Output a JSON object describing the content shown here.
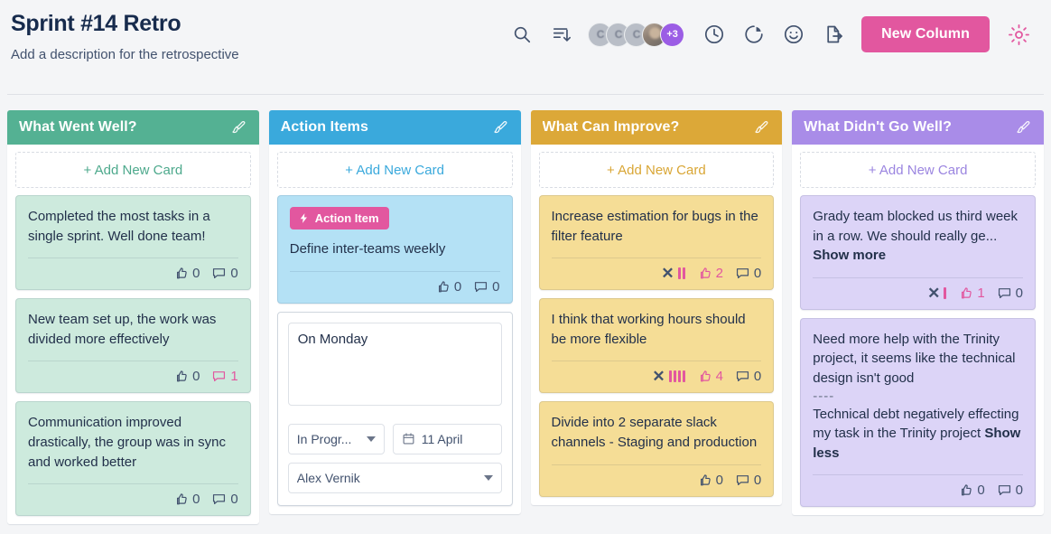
{
  "header": {
    "title": "Sprint #14 Retro",
    "description": "Add a description for the retrospective",
    "search_icon": "search-icon",
    "sort_icon": "sort-descending-icon",
    "timer_icon": "clock-icon",
    "chart_icon": "pie-chart-icon",
    "mood_icon": "smiley-icon",
    "export_icon": "export-icon",
    "settings_icon": "gear-icon",
    "new_column_label": "New Column",
    "avatars": [
      {
        "initials": "C",
        "type": "initials"
      },
      {
        "initials": "C",
        "type": "initials"
      },
      {
        "initials": "C",
        "type": "initials"
      },
      {
        "initials": "",
        "type": "photo"
      }
    ],
    "avatar_overflow": "+3"
  },
  "colors": {
    "accent_pink": "#e2579f",
    "green": "#54b193",
    "blue": "#3aa9dc",
    "amber": "#dca838",
    "purple": "#a98ce8",
    "page_bg": "#f4f5f7"
  },
  "add_card_label": "+ Add New Card",
  "columns": [
    {
      "title": "What Went Well?",
      "header_color": "#54b193",
      "card_color": "#cdeadd",
      "link_color": "#4da98c",
      "brush_icon": "brush-icon",
      "cards": [
        {
          "text": "Completed the most tasks in a single sprint. Well done team!",
          "votes": 0,
          "comments": 0,
          "vote_bars": 0,
          "voted": false,
          "commented": false,
          "show_clear": false
        },
        {
          "text": "New team set up, the work was divided more effectively",
          "votes": 0,
          "comments": 1,
          "vote_bars": 0,
          "voted": false,
          "commented": true,
          "show_clear": false
        },
        {
          "text": "Communication improved drastically, the group was in sync and worked better",
          "votes": 0,
          "comments": 0,
          "vote_bars": 0,
          "voted": false,
          "commented": false,
          "show_clear": false
        }
      ]
    },
    {
      "title": "Action Items",
      "header_color": "#3aa9dc",
      "card_color": "#b4e1f5",
      "link_color": "#3aa9dc",
      "brush_icon": "brush-icon",
      "cards": [
        {
          "badge": "Action Item",
          "badge_icon": "lightning-bolt-icon",
          "text": "Define inter-teams weekly",
          "votes": 0,
          "comments": 0,
          "vote_bars": 0,
          "voted": false,
          "commented": false,
          "show_clear": false
        },
        {
          "editing": true,
          "text": "On Monday",
          "status": "In Progr...",
          "date": "11 April",
          "date_icon": "calendar-icon",
          "assignee": "Alex Vernik"
        }
      ]
    },
    {
      "title": "What Can Improve?",
      "header_color": "#dca838",
      "card_color": "#f5dd96",
      "link_color": "#d9a635",
      "brush_icon": "brush-icon",
      "cards": [
        {
          "text": "Increase estimation for bugs in the filter feature",
          "votes": 2,
          "comments": 0,
          "vote_bars": 2,
          "voted": true,
          "commented": false,
          "show_clear": true
        },
        {
          "text": "I think that working hours should be more flexible",
          "votes": 4,
          "comments": 0,
          "vote_bars": 4,
          "voted": true,
          "commented": false,
          "show_clear": true
        },
        {
          "text": "Divide into 2 separate slack channels - Staging and production",
          "votes": 0,
          "comments": 0,
          "vote_bars": 0,
          "voted": false,
          "commented": false,
          "show_clear": false
        }
      ]
    },
    {
      "title": "What Didn't Go Well?",
      "header_color": "#a98ce8",
      "card_color": "#dcd4f7",
      "link_color": "#9b85e0",
      "brush_icon": "brush-icon",
      "cards": [
        {
          "text": "Grady team blocked us third week in a row. We should really ge...",
          "more_link": "Show more",
          "votes": 1,
          "comments": 0,
          "vote_bars": 1,
          "voted": true,
          "commented": false,
          "show_clear": true
        },
        {
          "text": "Need more help with the Trinity project, it seems like the technical design isn't good",
          "separator": "----",
          "text2": "Technical debt negatively effecting my task in the Trinity project",
          "more_link": "Show less",
          "votes": 0,
          "comments": 0,
          "vote_bars": 0,
          "voted": false,
          "commented": false,
          "show_clear": false
        }
      ]
    }
  ]
}
